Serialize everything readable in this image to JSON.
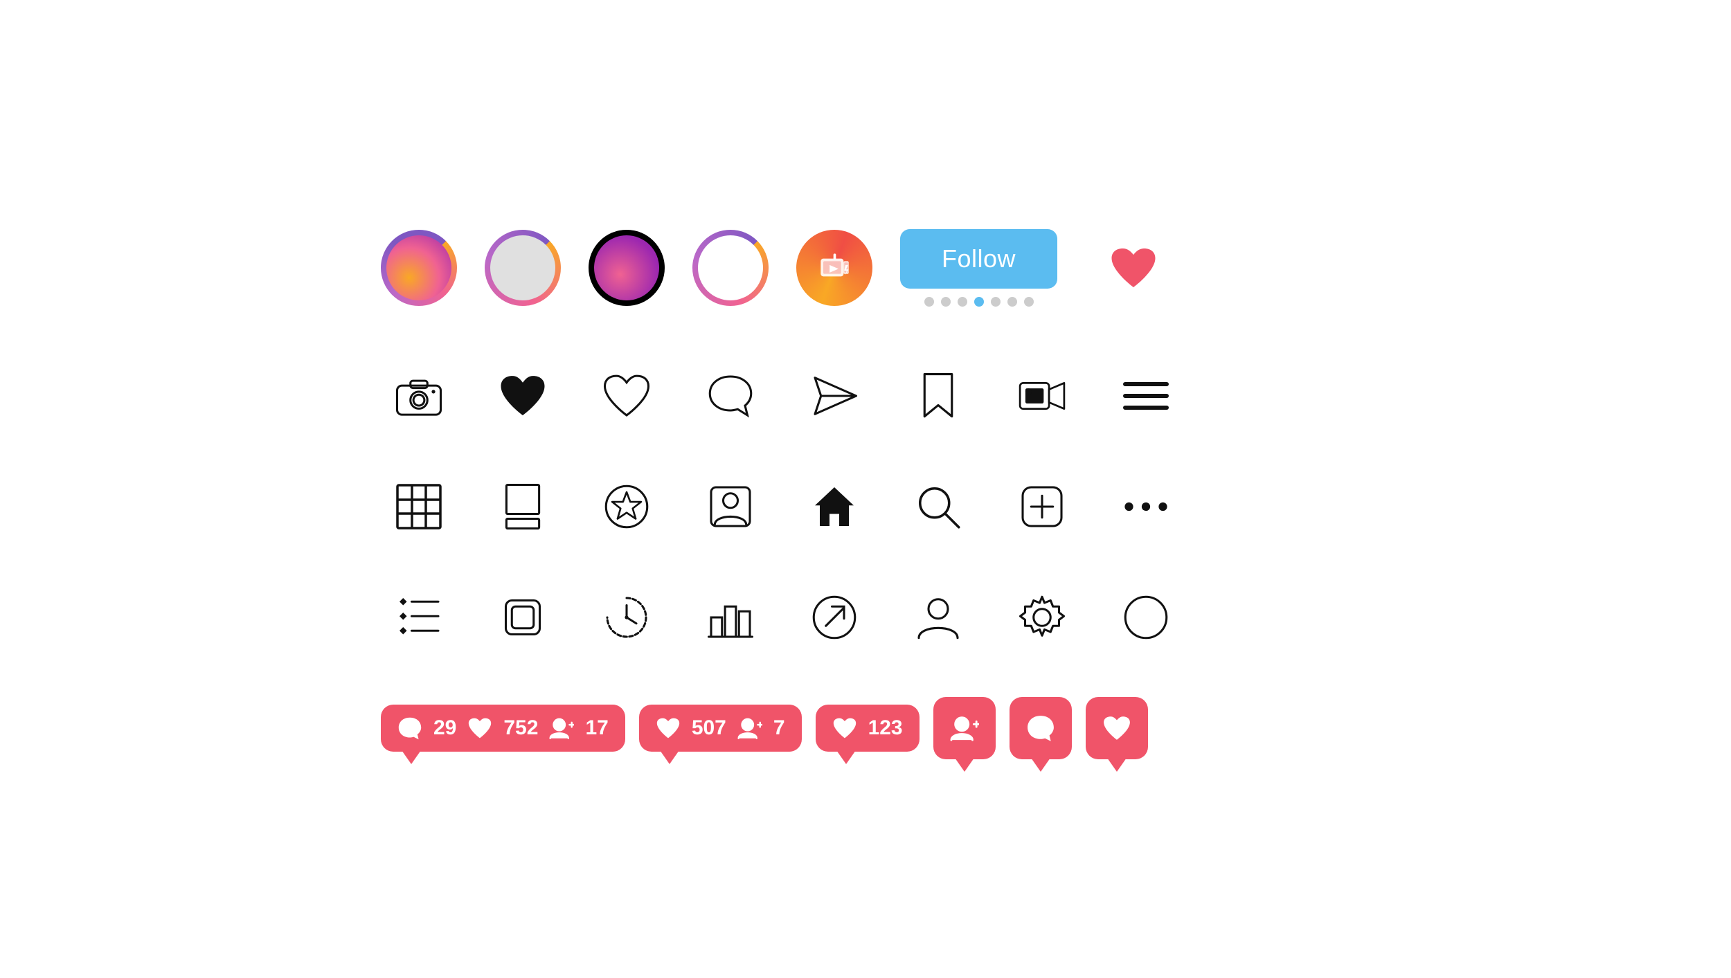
{
  "follow_button": {
    "label": "Follow"
  },
  "dots": [
    {
      "active": false
    },
    {
      "active": false
    },
    {
      "active": false
    },
    {
      "active": false
    },
    {
      "active": true
    },
    {
      "active": false
    },
    {
      "active": false
    }
  ],
  "notifications": [
    {
      "type": "combined",
      "comment_count": "29",
      "like_count": "752",
      "follow_count": "17"
    },
    {
      "type": "combined2",
      "like_count": "507",
      "follow_count": "7"
    },
    {
      "type": "like_only",
      "like_count": "123"
    },
    {
      "type": "single_follow"
    },
    {
      "type": "single_comment"
    },
    {
      "type": "single_like"
    }
  ]
}
